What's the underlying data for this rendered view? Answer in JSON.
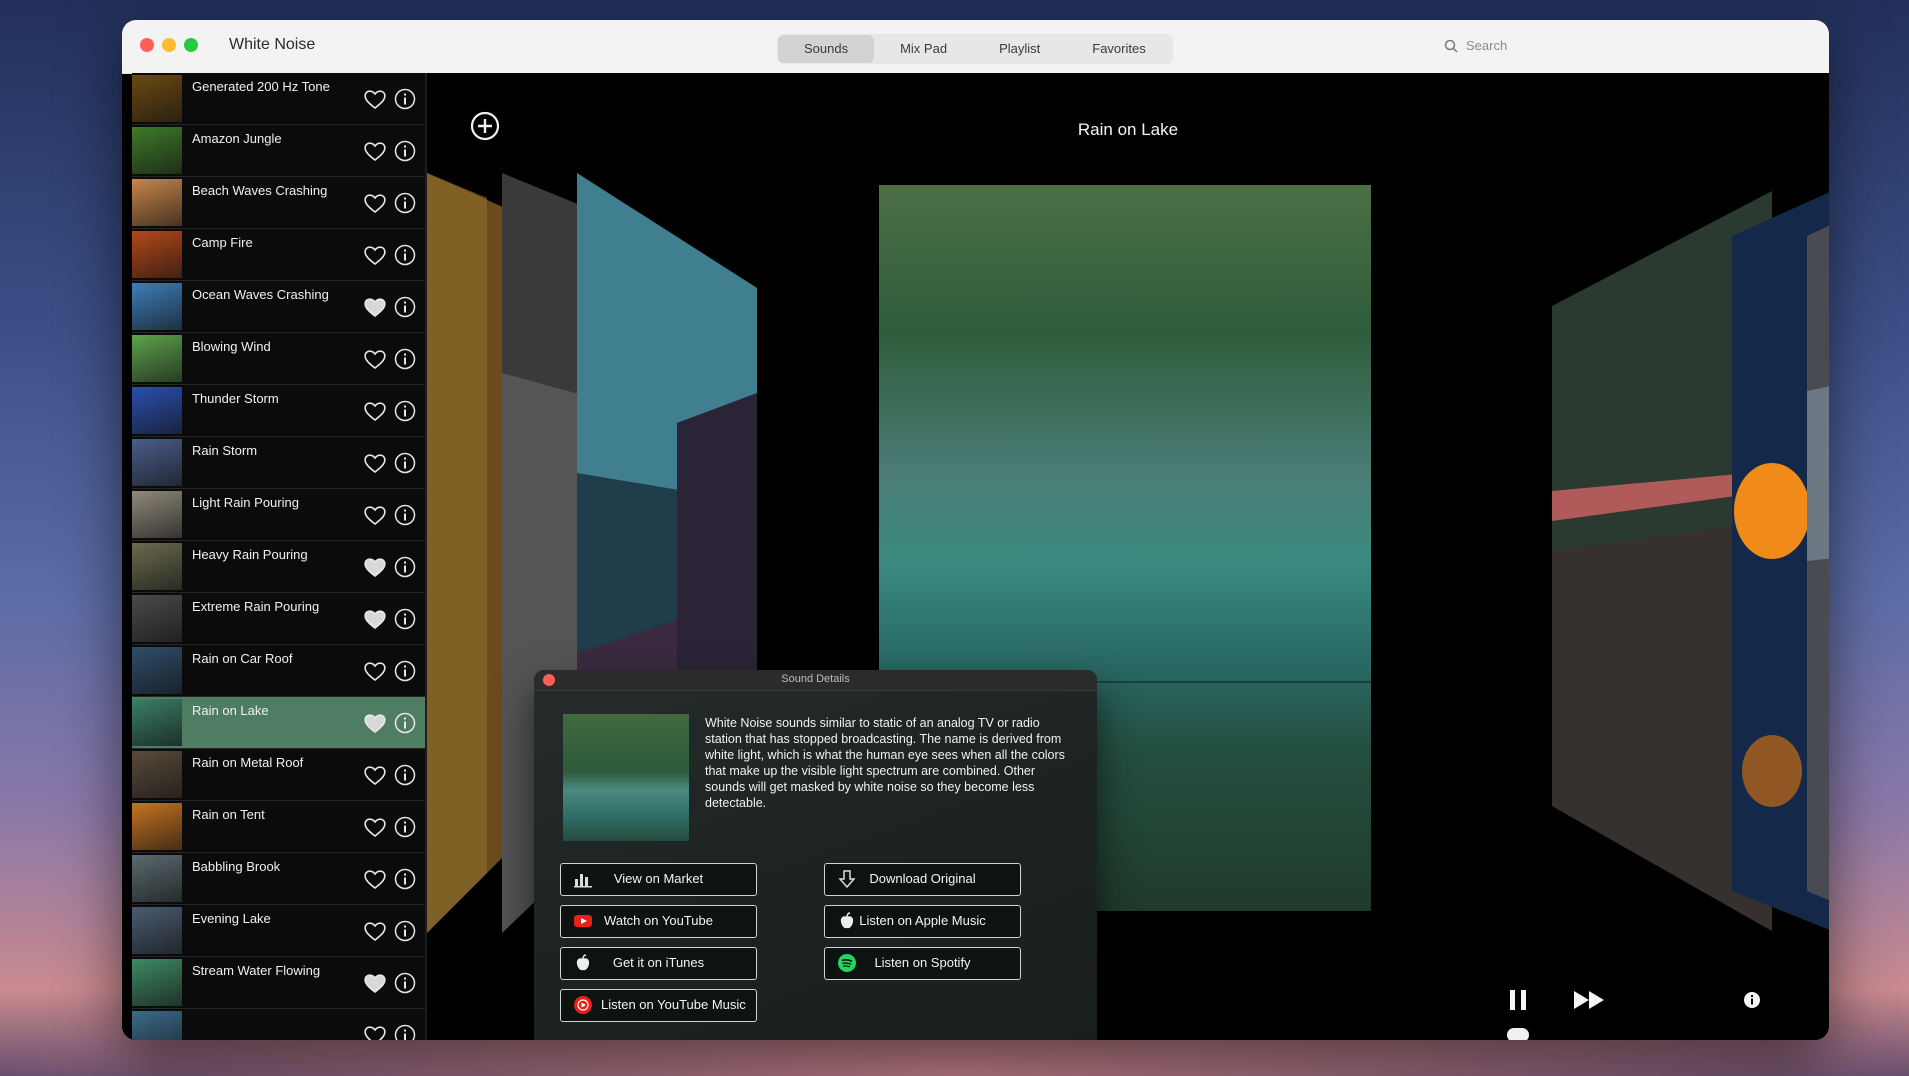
{
  "window": {
    "app_title": "White Noise",
    "tabs": [
      {
        "label": "Sounds",
        "active": true
      },
      {
        "label": "Mix Pad",
        "active": false
      },
      {
        "label": "Playlist",
        "active": false
      },
      {
        "label": "Favorites",
        "active": false
      }
    ],
    "search_placeholder": "Search"
  },
  "sidebar": {
    "items": [
      {
        "label": "Generated 200 Hz Tone",
        "favorite": false,
        "thumb_color": "#6b4a10"
      },
      {
        "label": "Amazon Jungle",
        "favorite": false,
        "thumb_color": "#3f7a2a"
      },
      {
        "label": "Beach Waves Crashing",
        "favorite": false,
        "thumb_color": "#c9864a"
      },
      {
        "label": "Camp Fire",
        "favorite": false,
        "thumb_color": "#b4481a"
      },
      {
        "label": "Ocean Waves Crashing",
        "favorite": true,
        "thumb_color": "#3c7fb8"
      },
      {
        "label": "Blowing Wind",
        "favorite": false,
        "thumb_color": "#5ea34b"
      },
      {
        "label": "Thunder Storm",
        "favorite": false,
        "thumb_color": "#2b4fb0"
      },
      {
        "label": "Rain Storm",
        "favorite": false,
        "thumb_color": "#4a5e8a"
      },
      {
        "label": "Light Rain Pouring",
        "favorite": false,
        "thumb_color": "#8f8a7a"
      },
      {
        "label": "Heavy Rain Pouring",
        "favorite": true,
        "thumb_color": "#6a6a4f"
      },
      {
        "label": "Extreme Rain Pouring",
        "favorite": true,
        "thumb_color": "#4a4a4a"
      },
      {
        "label": "Rain on Car Roof",
        "favorite": false,
        "thumb_color": "#2f4d6a"
      },
      {
        "label": "Rain on Lake",
        "favorite": true,
        "thumb_color": "#3a7f66",
        "selected": true
      },
      {
        "label": "Rain on Metal Roof",
        "favorite": false,
        "thumb_color": "#5a4a3a"
      },
      {
        "label": "Rain on Tent",
        "favorite": false,
        "thumb_color": "#c6741f"
      },
      {
        "label": "Babbling Brook",
        "favorite": false,
        "thumb_color": "#5a6a6f"
      },
      {
        "label": "Evening Lake",
        "favorite": false,
        "thumb_color": "#4a5c70"
      },
      {
        "label": "Stream Water Flowing",
        "favorite": true,
        "thumb_color": "#3d8a62"
      },
      {
        "label": "",
        "favorite": false,
        "thumb_color": "#3a6a8a"
      }
    ]
  },
  "stage": {
    "title": "Rain on Lake"
  },
  "sound_details": {
    "window_title": "Sound Details",
    "description": "White Noise sounds similar to static of an analog TV or radio station that has stopped broadcasting. The name is derived from white light, which is what the human eye sees when all the colors that make up the visible light spectrum are combined. Other sounds will get masked by white noise so they become less detectable.",
    "buttons": {
      "view_market": "View on Market",
      "download_original": "Download Original",
      "watch_youtube": "Watch on YouTube",
      "apple_music": "Listen on Apple Music",
      "itunes": "Get it on iTunes",
      "spotify": "Listen on Spotify",
      "youtube_music": "Listen on YouTube Music"
    }
  },
  "colors": {
    "selected_row": "#4f7d63",
    "youtube_red": "#e62117",
    "spotify_green": "#1ed760"
  }
}
